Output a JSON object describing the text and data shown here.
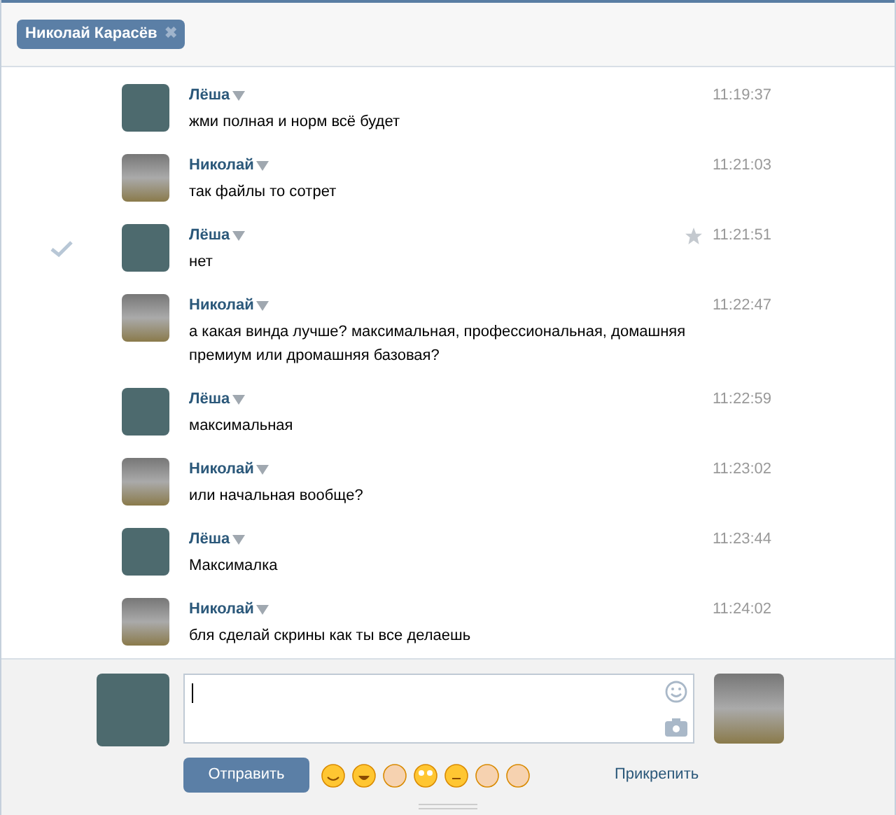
{
  "tab": {
    "label": "Николай Карасёв",
    "close": "✖"
  },
  "messages": [
    {
      "author": "Лёша",
      "kind": "person",
      "time": "11:19:37",
      "text": "жми полная и норм всё будет",
      "selected": false
    },
    {
      "author": "Николай",
      "kind": "car",
      "time": "11:21:03",
      "text": "так файлы то сотрет",
      "selected": false
    },
    {
      "author": "Лёша",
      "kind": "person",
      "time": "11:21:51",
      "text": "нет",
      "selected": true
    },
    {
      "author": "Николай",
      "kind": "car",
      "time": "11:22:47",
      "text": "а какая винда лучше? максимальная, профессиональная, домашняя премиум или дромашняя базовая?",
      "selected": false
    },
    {
      "author": "Лёша",
      "kind": "person",
      "time": "11:22:59",
      "text": "максимальная",
      "selected": false
    },
    {
      "author": "Николай",
      "kind": "car",
      "time": "11:23:02",
      "text": "или начальная вообще?",
      "selected": false
    },
    {
      "author": "Лёша",
      "kind": "person",
      "time": "11:23:44",
      "text": "Максималка",
      "selected": false
    },
    {
      "author": "Николай",
      "kind": "car",
      "time": "11:24:02",
      "text": "бля сделай скрины как ты все делаешь",
      "selected": false
    }
  ],
  "composer": {
    "send": "Отправить",
    "attach": "Прикрепить",
    "my_avatar": {
      "kind": "person"
    },
    "peer_avatar": {
      "kind": "car"
    }
  }
}
